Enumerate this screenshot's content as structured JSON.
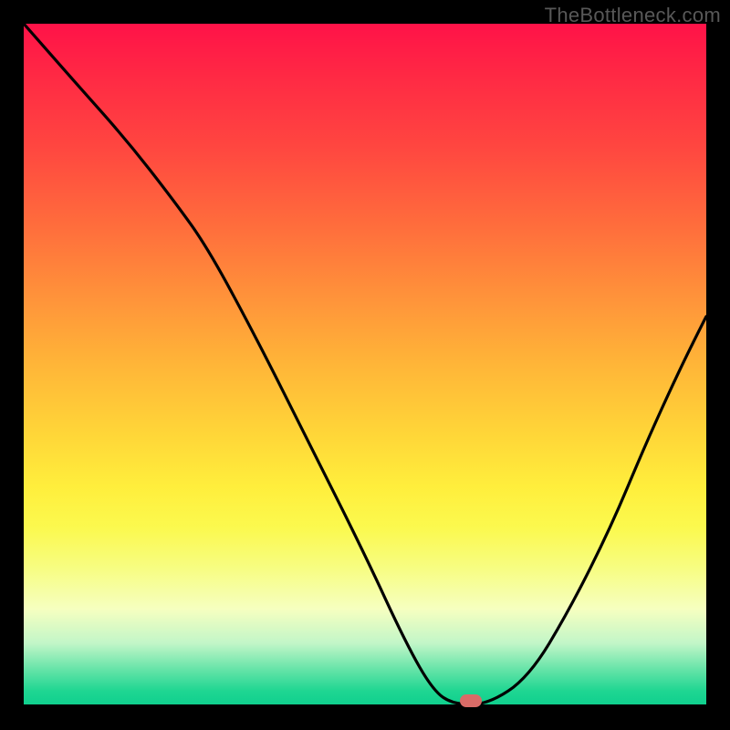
{
  "watermark": "TheBottleneck.com",
  "colors": {
    "frame_bg": "#000000",
    "marker": "#d96b67",
    "curve": "#000000"
  },
  "chart_data": {
    "type": "line",
    "title": "",
    "xlabel": "",
    "ylabel": "",
    "xlim": [
      0,
      1
    ],
    "ylim": [
      0,
      1
    ],
    "x": [
      0.0,
      0.07,
      0.15,
      0.22,
      0.27,
      0.34,
      0.42,
      0.5,
      0.56,
      0.6,
      0.63,
      0.68,
      0.74,
      0.8,
      0.86,
      0.91,
      0.96,
      1.0
    ],
    "values": [
      1.0,
      0.92,
      0.83,
      0.74,
      0.67,
      0.54,
      0.38,
      0.22,
      0.09,
      0.02,
      0.0,
      0.0,
      0.04,
      0.14,
      0.26,
      0.38,
      0.49,
      0.57
    ],
    "marker": {
      "x": 0.655,
      "y": 0.0
    },
    "legend": false,
    "grid": false
  }
}
